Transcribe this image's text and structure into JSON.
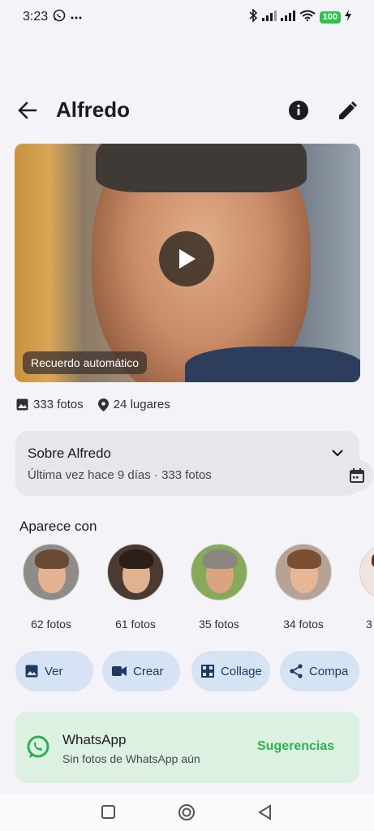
{
  "status": {
    "time": "3:23",
    "battery": "100"
  },
  "header": {
    "title": "Alfredo"
  },
  "hero": {
    "chip": "Recuerdo automático"
  },
  "stats": {
    "photos": "333 fotos",
    "places": "24 lugares"
  },
  "about": {
    "title": "Sobre Alfredo",
    "subtitle": "Última vez hace 9 días · 333 fotos"
  },
  "appears_with": {
    "title": "Aparece con",
    "people": [
      {
        "count": "62 fotos"
      },
      {
        "count": "61 fotos"
      },
      {
        "count": "35 fotos"
      },
      {
        "count": "34 fotos"
      },
      {
        "count": "3"
      }
    ]
  },
  "actions": {
    "view": "Ver",
    "create": "Crear",
    "collage": "Collage",
    "share": "Compa"
  },
  "whatsapp": {
    "title": "WhatsApp",
    "subtitle": "Sin fotos de WhatsApp aún",
    "action": "Sugerencias"
  },
  "colors": {
    "accent": "#d6e3f4",
    "whatsapp": "#2db04f",
    "battery": "#2cc34a"
  }
}
